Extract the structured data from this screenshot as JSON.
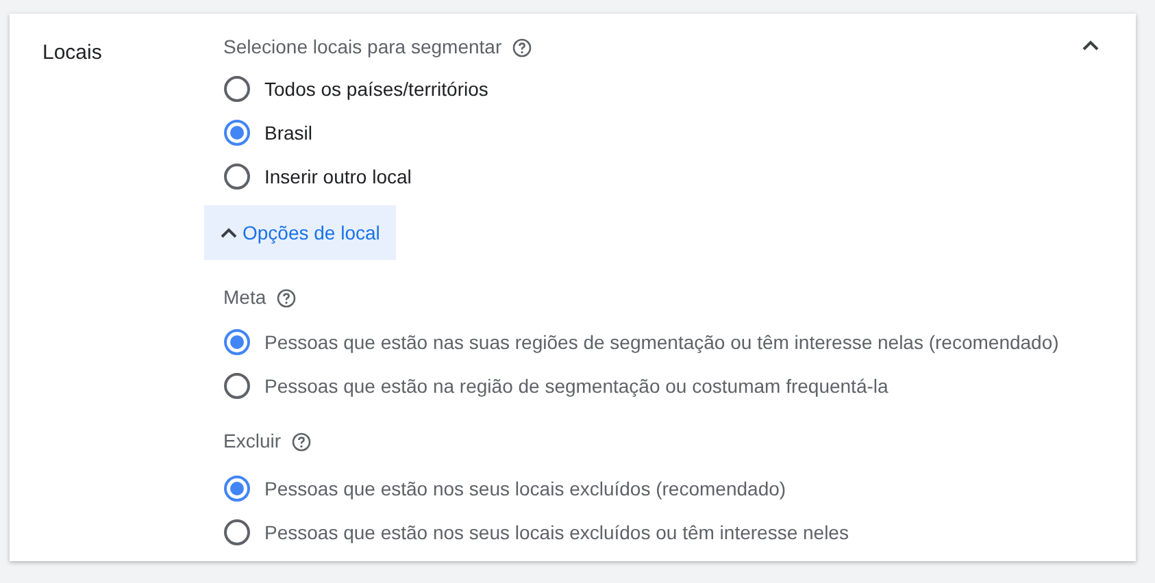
{
  "section": {
    "title": "Locais",
    "expanded": true
  },
  "targeting": {
    "label": "Selecione locais para segmentar",
    "options": [
      {
        "label": "Todos os países/territórios",
        "selected": false
      },
      {
        "label": "Brasil",
        "selected": true
      },
      {
        "label": "Inserir outro local",
        "selected": false
      }
    ]
  },
  "location_options": {
    "label": "Opções de local",
    "expanded": true
  },
  "groups": [
    {
      "label": "Meta",
      "options": [
        {
          "label": "Pessoas que estão nas suas regiões de segmentação ou têm interesse nelas (recomendado)",
          "selected": true
        },
        {
          "label": "Pessoas que estão na região de segmentação ou costumam frequentá-la",
          "selected": false
        }
      ]
    },
    {
      "label": "Excluir",
      "options": [
        {
          "label": "Pessoas que estão nos seus locais excluídos (recomendado)",
          "selected": true
        },
        {
          "label": "Pessoas que estão nos seus locais excluídos ou têm interesse neles",
          "selected": false
        }
      ]
    }
  ]
}
